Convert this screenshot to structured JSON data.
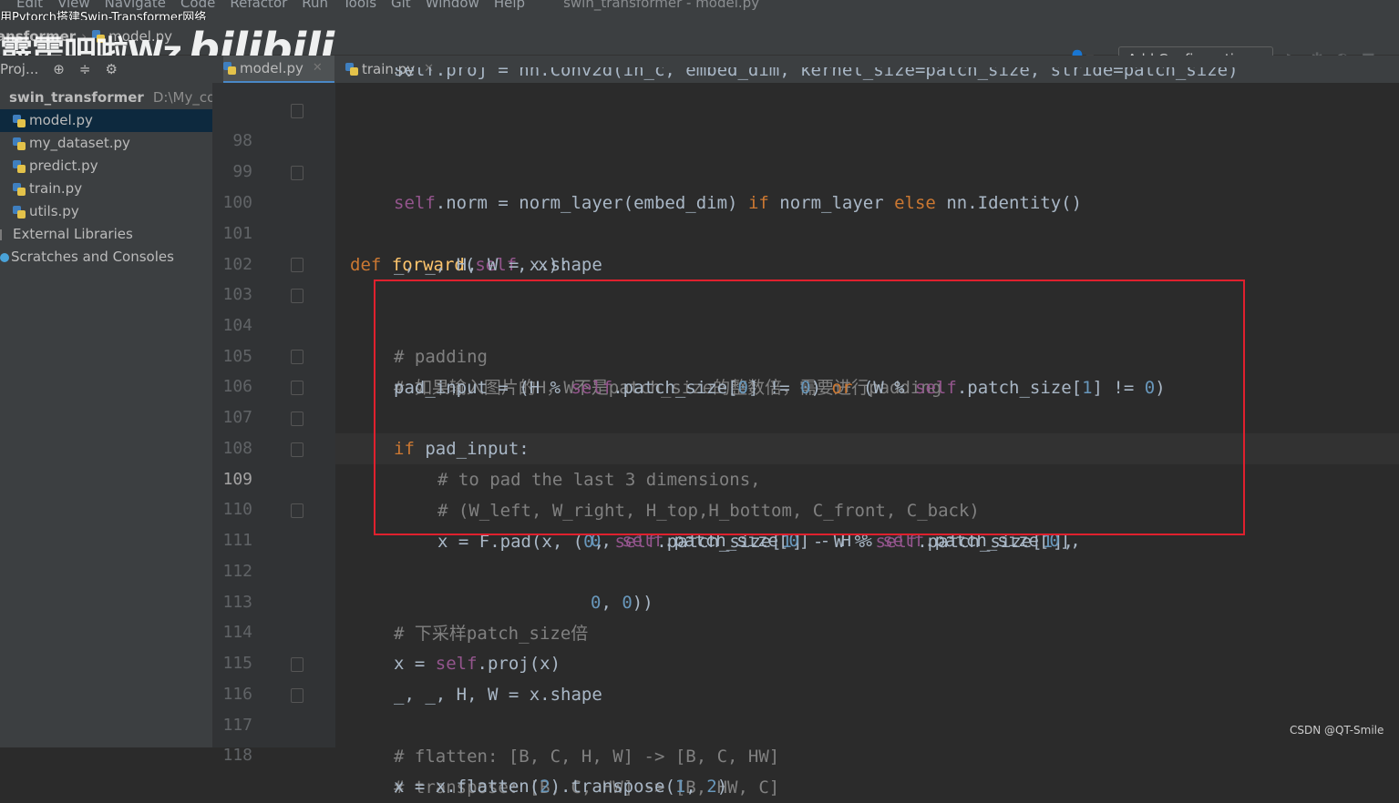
{
  "overlay_title": "用Pytorch搭建Swin-Transformer网络",
  "menubar": {
    "items": [
      "Edit",
      "View",
      "Navigate",
      "Code",
      "Refactor",
      "Run",
      "Tools",
      "Git",
      "Window",
      "Help"
    ],
    "window_title": "swin_transformer - model.py"
  },
  "navbar": {
    "project": "ansformer",
    "file": "model.py",
    "add_configuration": "Add Configuration..."
  },
  "watermark": {
    "text": "霹雳吧啦Wz",
    "brand": "bilibili"
  },
  "sidebar": {
    "header": "Proj...",
    "root": {
      "name": "swin_transformer",
      "path": "D:\\My_code"
    },
    "files": [
      "model.py",
      "my_dataset.py",
      "predict.py",
      "train.py",
      "utils.py"
    ],
    "external_libraries": "External Libraries",
    "scratches": "Scratches and Consoles"
  },
  "tabs": [
    {
      "label": "model.py",
      "active": true
    },
    {
      "label": "train.py",
      "active": false
    }
  ],
  "editor": {
    "current_line": 109,
    "partial_top": "self.proj = nn.Conv2d(in_c, embed_dim, kernel_size=patch_size, stride=patch_size)",
    "lines": {
      "n98": "98",
      "n99": "99",
      "n100": "100",
      "n101": "101",
      "n102": "102",
      "n103": "103",
      "n104": "104",
      "n105": "105",
      "n106": "106",
      "n107": "107",
      "n108": "108",
      "n109": "109",
      "n110": "110",
      "n111": "111",
      "n112": "112",
      "n113": "113",
      "n114": "114",
      "n115": "115",
      "n116": "116",
      "n117": "117",
      "n118": "118"
    },
    "code": {
      "l98_self": "self",
      "l98_a": ".norm = norm_layer(embed_dim) ",
      "l98_if": "if",
      "l98_b": " norm_layer ",
      "l98_else": "else",
      "l98_c": " nn.Identity()",
      "l100_def": "def",
      "l100_fn": "forward",
      "l100_a": "(",
      "l100_self": "self",
      "l100_b": ", x):",
      "l101": "_, _, H, W = x.shape",
      "l103": "# padding",
      "l104": "# 如果输入图片的H，W不是patch_size的整数倍，需要进行padding",
      "l105_a": "pad_input = (H % ",
      "l105_self1": "self",
      "l105_b": ".patch_size[",
      "l105_n0": "0",
      "l105_c": "] != ",
      "l105_n0b": "0",
      "l105_d": ") ",
      "l105_or": "or",
      "l105_e": " (W % ",
      "l105_self2": "self",
      "l105_f": ".patch_size[",
      "l105_n1": "1",
      "l105_g": "] != ",
      "l105_n0c": "0",
      "l105_h": ")",
      "l106_if": "if",
      "l106_a": " pad_input:",
      "l107": "# to pad the last 3 dimensions,",
      "l108": "# (W_left, W_right, H_top,H_bottom, C_front, C_back)",
      "l109_a": "x = F.pad(x, (",
      "l109_n0": "0",
      "l109_b": ", ",
      "l109_self1": "self",
      "l109_c": ".patch_size[",
      "l109_n1": "1",
      "l109_d": "] - W % ",
      "l109_self2": "self",
      "l109_e": ".patch_size[",
      "l109_n1b": "1",
      "l109_f": "],",
      "l110_n0": "0",
      "l110_a": ", ",
      "l110_self1": "self",
      "l110_b": ".patch_size[",
      "l110_n0b": "0",
      "l110_c": "] - H % ",
      "l110_self2": "self",
      "l110_d": ".patch_size[",
      "l110_n0c": "0",
      "l110_e": "],",
      "l111_n0": "0",
      "l111_a": ", ",
      "l111_n0b": "0",
      "l111_b": "))",
      "l113": "# 下采样patch_size倍",
      "l114_a": "x = ",
      "l114_self": "self",
      "l114_b": ".proj(x)",
      "l115": "_, _, H, W = x.shape",
      "l116": "# flatten: [B, C, H, W] -> [B, C, HW]",
      "l117": "# transpose: [B, C, HW] -> [B, HW, C]",
      "l118_a": "x = x.flatten(",
      "l118_n2": "2",
      "l118_b": ").transpose(",
      "l118_n1": "1",
      "l118_c": ", ",
      "l118_n2b": "2",
      "l118_d": ")"
    }
  },
  "csdn_watermark": "CSDN @QT-Smile",
  "colors": {
    "keyword": "#cc7832",
    "self": "#94558d",
    "number": "#6897bb",
    "comment": "#808080",
    "function": "#ffc66d",
    "highlight_box": "#e0202e"
  }
}
